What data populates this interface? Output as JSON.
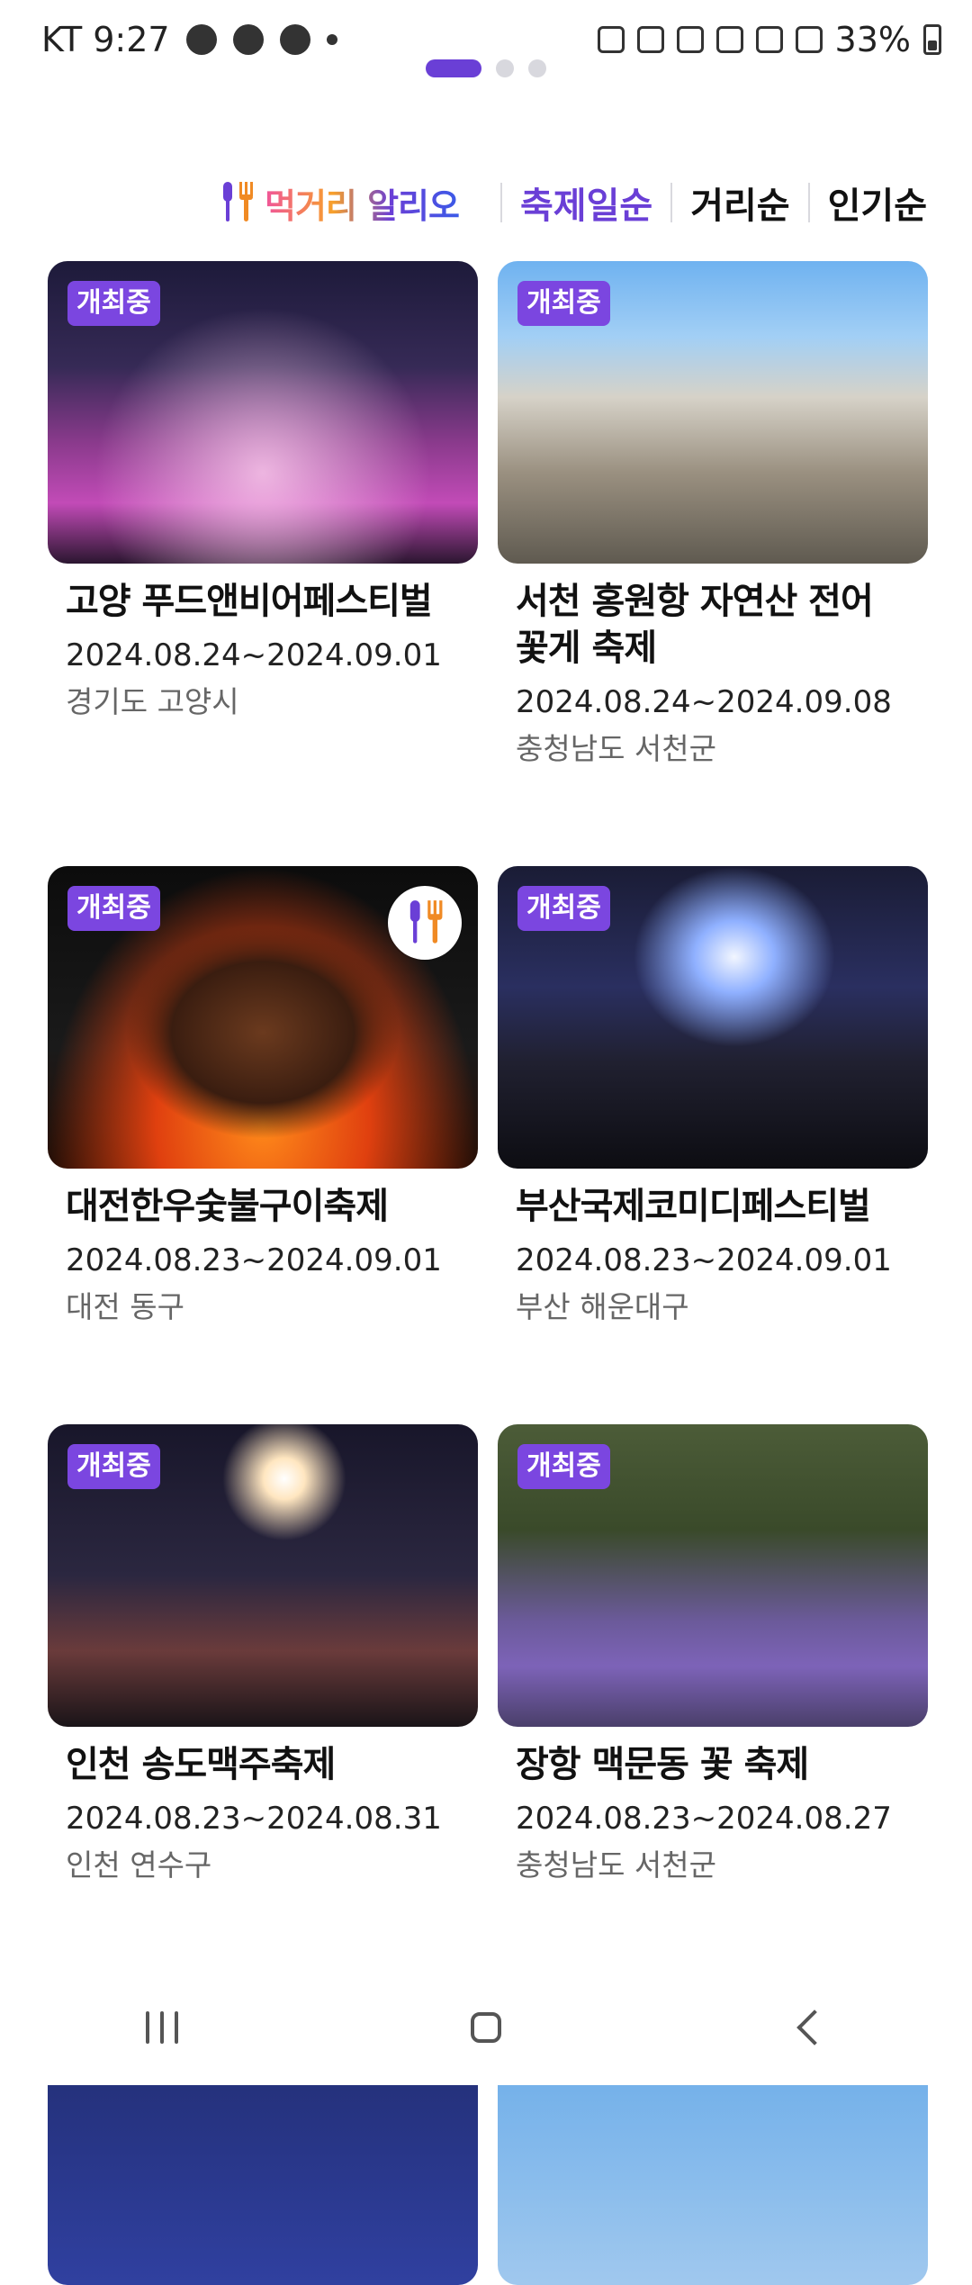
{
  "status_bar": {
    "carrier_time": "KT 9:27",
    "battery": "33%"
  },
  "sort": {
    "logo_text": "먹거리 알리오",
    "options": [
      "축제일순",
      "거리순",
      "인기순"
    ],
    "active": "축제일순"
  },
  "festivals": [
    {
      "badge": "개최중",
      "title": "고양 푸드앤비어페스티벌",
      "dates": "2024.08.24~2024.09.01",
      "location": "경기도 고양시"
    },
    {
      "badge": "개최중",
      "title": "서천 홍원항 자연산 전어 꽃게 축제",
      "dates": "2024.08.24~2024.09.08",
      "location": "충청남도 서천군"
    },
    {
      "badge": "개최중",
      "title": "대전한우숯불구이축제",
      "dates": "2024.08.23~2024.09.01",
      "location": "대전 동구",
      "food_icon": "fork-spoon-icon"
    },
    {
      "badge": "개최중",
      "title": "부산국제코미디페스티벌",
      "dates": "2024.08.23~2024.09.01",
      "location": "부산 해운대구"
    },
    {
      "badge": "개최중",
      "title": "인천 송도맥주축제",
      "dates": "2024.08.23~2024.08.31",
      "location": "인천 연수구"
    },
    {
      "badge": "개최중",
      "title": "장항 맥문동 꽃 축제",
      "dates": "2024.08.23~2024.08.27",
      "location": "충청남도 서천군"
    }
  ],
  "colors": {
    "accent": "#6a3fd6",
    "badge": "#7b46e0"
  }
}
